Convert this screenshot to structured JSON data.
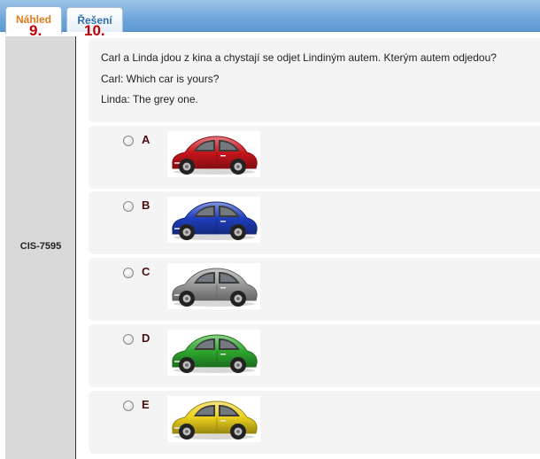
{
  "tabs": [
    {
      "label": "Náhled",
      "number": "9."
    },
    {
      "label": "Řešení",
      "number": "10."
    }
  ],
  "sidebar": {
    "code": "CIS-7595"
  },
  "question": {
    "lines": [
      "Carl a Linda jdou z kina a chystají se odjet Lindiným autem. Kterým autem odjedou?",
      "Carl: Which car is yours?",
      "Linda: The grey one."
    ]
  },
  "options": [
    {
      "letter": "A",
      "car_icon": "red-car-icon",
      "color": "#c8141c"
    },
    {
      "letter": "B",
      "car_icon": "blue-car-icon",
      "color": "#1f3fbf"
    },
    {
      "letter": "C",
      "car_icon": "grey-car-icon",
      "color": "#9a9a9a"
    },
    {
      "letter": "D",
      "car_icon": "green-car-icon",
      "color": "#2ea82e"
    },
    {
      "letter": "E",
      "car_icon": "yellow-car-icon",
      "color": "#ecd01c"
    }
  ]
}
